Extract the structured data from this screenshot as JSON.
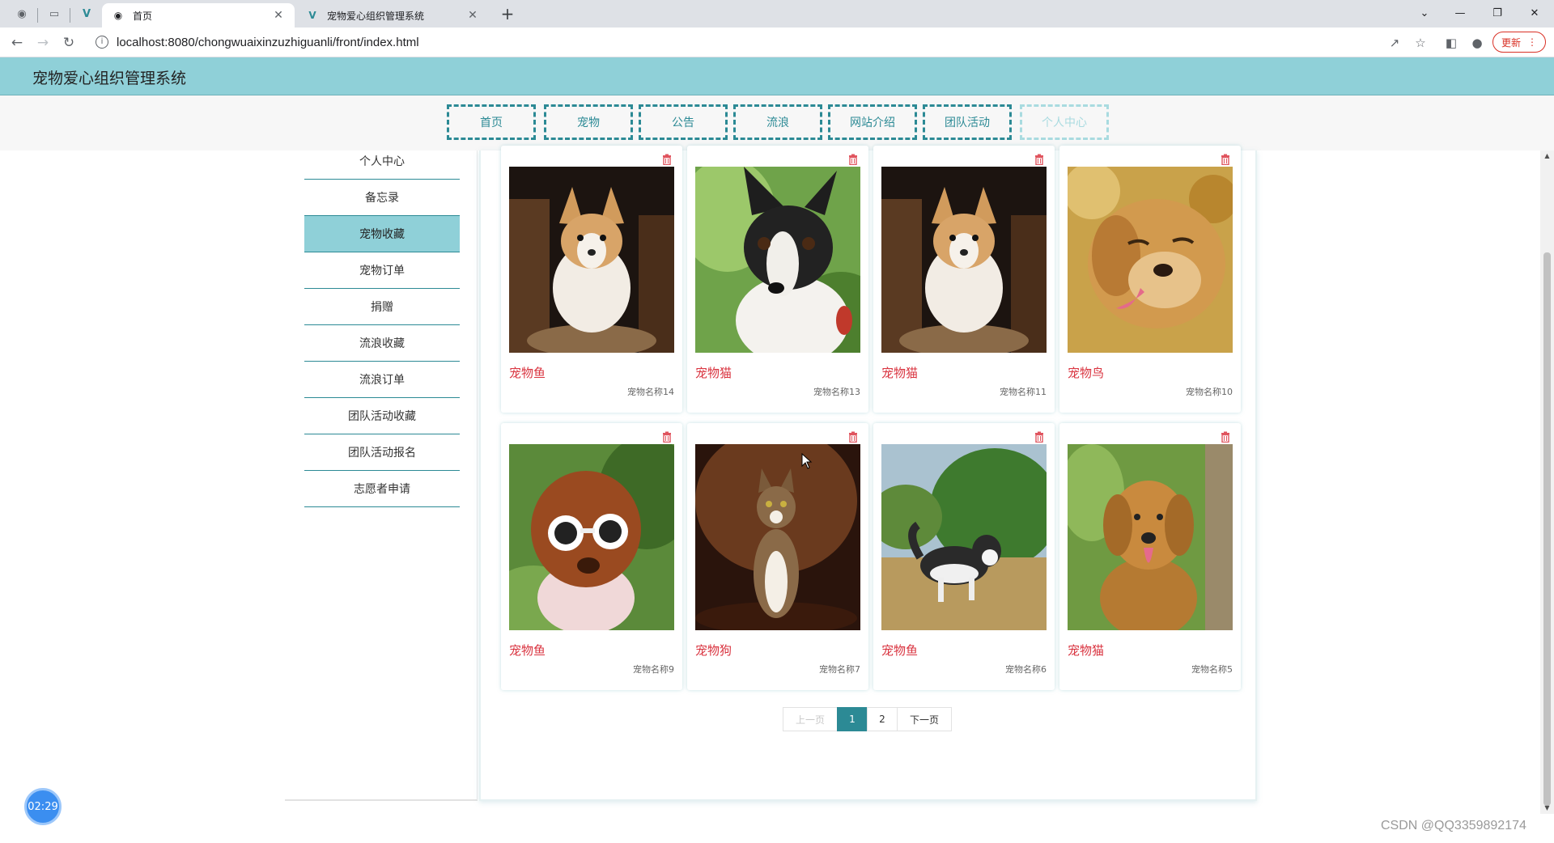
{
  "browser": {
    "tabs": [
      {
        "title": "首页",
        "active": true
      },
      {
        "title": "宠物爱心组织管理系统",
        "active": false
      }
    ],
    "url": "localhost:8080/chongwuaixinzuzhiguanli/front/index.html",
    "update_label": "更新"
  },
  "site": {
    "title": "宠物爱心组织管理系统"
  },
  "nav": {
    "items": [
      "首页",
      "宠物",
      "公告",
      "流浪",
      "网站介绍",
      "团队活动",
      "个人中心"
    ]
  },
  "sidebar": {
    "items": [
      "个人中心",
      "备忘录",
      "宠物收藏",
      "宠物订单",
      "捐赠",
      "流浪收藏",
      "流浪订单",
      "团队活动收藏",
      "团队活动报名",
      "志愿者申请"
    ],
    "active_index": 2
  },
  "cards": [
    {
      "type": "宠物鱼",
      "name": "宠物名称14",
      "image": "corgi-photo"
    },
    {
      "type": "宠物猫",
      "name": "宠物名称13",
      "image": "chihuahua-photo"
    },
    {
      "type": "宠物猫",
      "name": "宠物名称11",
      "image": "corgi-photo"
    },
    {
      "type": "宠物鸟",
      "name": "宠物名称10",
      "image": "golden-retriever-photo"
    },
    {
      "type": "宠物鱼",
      "name": "宠物名称9",
      "image": "poodle-goggles-photo"
    },
    {
      "type": "宠物狗",
      "name": "宠物名称7",
      "image": "cat-photo"
    },
    {
      "type": "宠物鱼",
      "name": "宠物名称6",
      "image": "husky-photo"
    },
    {
      "type": "宠物猫",
      "name": "宠物名称5",
      "image": "golden-retriever-photo"
    }
  ],
  "pagination": {
    "prev_label": "上一页",
    "pages": [
      "1",
      "2"
    ],
    "current": "1",
    "next_label": "下一页"
  },
  "timer": "02:29",
  "watermark": "CSDN @QQ3359892174",
  "colors": {
    "header_bg": "#8fd0d8",
    "accent": "#2c8a95",
    "price_red": "#d9333f"
  }
}
